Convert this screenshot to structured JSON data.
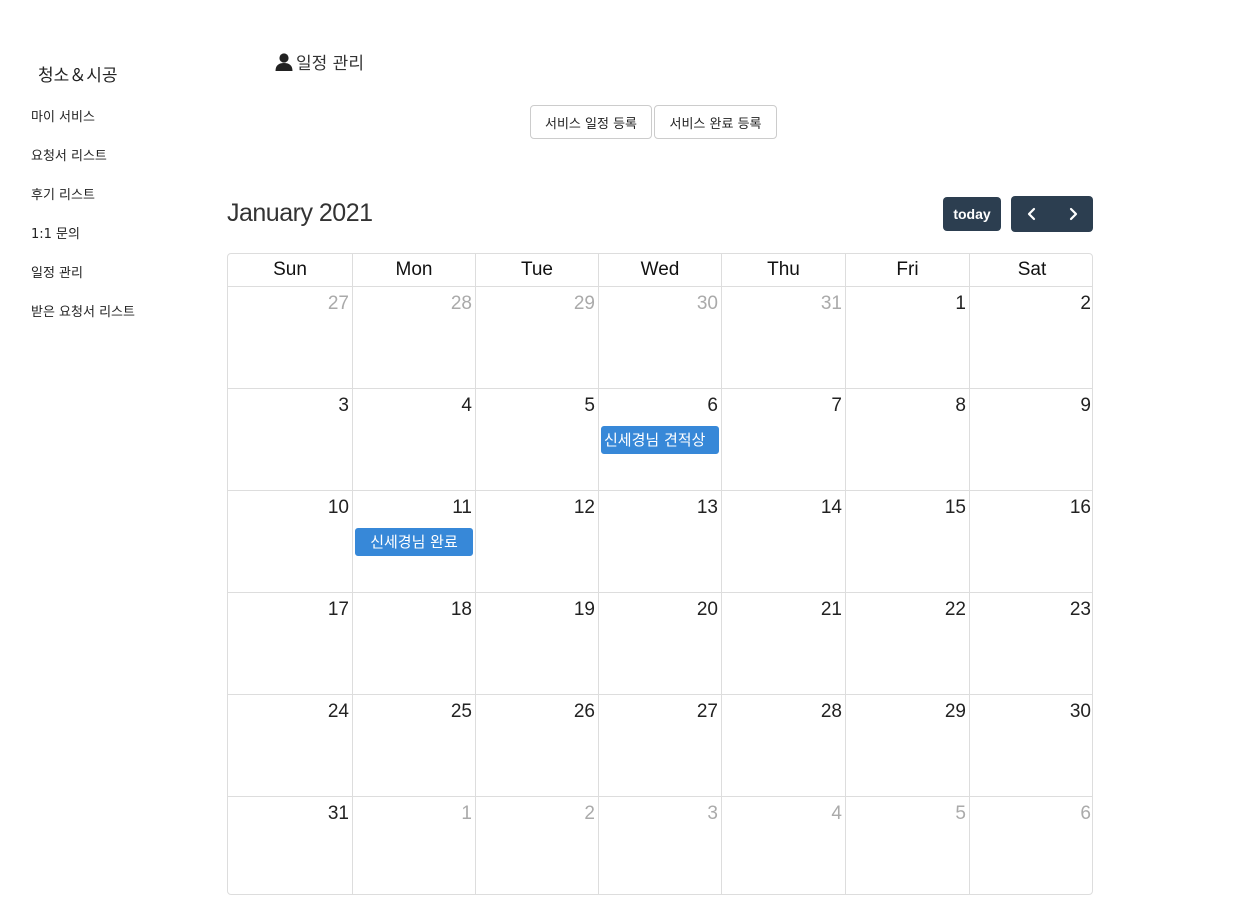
{
  "sidebar": {
    "brand": "청소＆시공",
    "items": [
      {
        "label": "마이 서비스"
      },
      {
        "label": "요청서 리스트"
      },
      {
        "label": "후기 리스트"
      },
      {
        "label": "1:1 문의"
      },
      {
        "label": "일정 관리"
      },
      {
        "label": "받은 요청서 리스트"
      }
    ]
  },
  "header": {
    "icon": "user-icon",
    "title": "일정 관리"
  },
  "actions": {
    "register_schedule": "서비스 일정 등록",
    "register_complete": "서비스 완료 등록"
  },
  "calendar": {
    "title": "January 2021",
    "today_label": "today",
    "prev_icon": "chevron-left-icon",
    "next_icon": "chevron-right-icon",
    "accent_color": "#2c3e50",
    "event_color": "#3788d8",
    "weekdays": [
      "Sun",
      "Mon",
      "Tue",
      "Wed",
      "Thu",
      "Fri",
      "Sat"
    ],
    "weeks": [
      [
        {
          "d": "27",
          "other": true
        },
        {
          "d": "28",
          "other": true
        },
        {
          "d": "29",
          "other": true
        },
        {
          "d": "30",
          "other": true
        },
        {
          "d": "31",
          "other": true
        },
        {
          "d": "1"
        },
        {
          "d": "2"
        }
      ],
      [
        {
          "d": "3"
        },
        {
          "d": "4"
        },
        {
          "d": "5"
        },
        {
          "d": "6",
          "event": "신세경님 견적상"
        },
        {
          "d": "7"
        },
        {
          "d": "8"
        },
        {
          "d": "9"
        }
      ],
      [
        {
          "d": "10"
        },
        {
          "d": "11",
          "event": "신세경님 완료"
        },
        {
          "d": "12"
        },
        {
          "d": "13"
        },
        {
          "d": "14"
        },
        {
          "d": "15"
        },
        {
          "d": "16"
        }
      ],
      [
        {
          "d": "17"
        },
        {
          "d": "18"
        },
        {
          "d": "19"
        },
        {
          "d": "20"
        },
        {
          "d": "21"
        },
        {
          "d": "22"
        },
        {
          "d": "23"
        }
      ],
      [
        {
          "d": "24"
        },
        {
          "d": "25"
        },
        {
          "d": "26"
        },
        {
          "d": "27"
        },
        {
          "d": "28"
        },
        {
          "d": "29"
        },
        {
          "d": "30"
        }
      ],
      [
        {
          "d": "31"
        },
        {
          "d": "1",
          "other": true
        },
        {
          "d": "2",
          "other": true
        },
        {
          "d": "3",
          "other": true
        },
        {
          "d": "4",
          "other": true
        },
        {
          "d": "5",
          "other": true
        },
        {
          "d": "6",
          "other": true
        }
      ]
    ]
  }
}
